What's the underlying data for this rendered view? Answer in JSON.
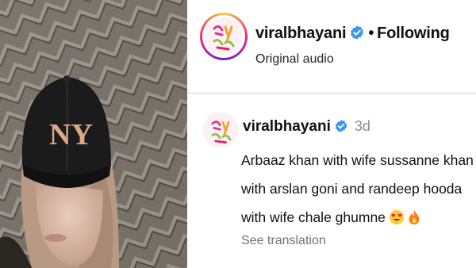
{
  "header": {
    "username": "viralbhayani",
    "separator": "•",
    "follow_status": "Following",
    "audio_label": "Original audio"
  },
  "comment": {
    "username": "viralbhayani",
    "time": "3d",
    "lines": [
      "Arbaaz khan with wife sussanne khan",
      "with arslan goni and randeep hooda",
      "with wife chale ghumne"
    ],
    "emojis": [
      "heart-eyes-emoji",
      "fire-emoji"
    ],
    "see_translation": "See translation"
  },
  "photo": {
    "cap_logo": "NY"
  },
  "colors": {
    "verified": "#3897f0",
    "muted": "#737373",
    "divider": "#dbdbdb"
  }
}
